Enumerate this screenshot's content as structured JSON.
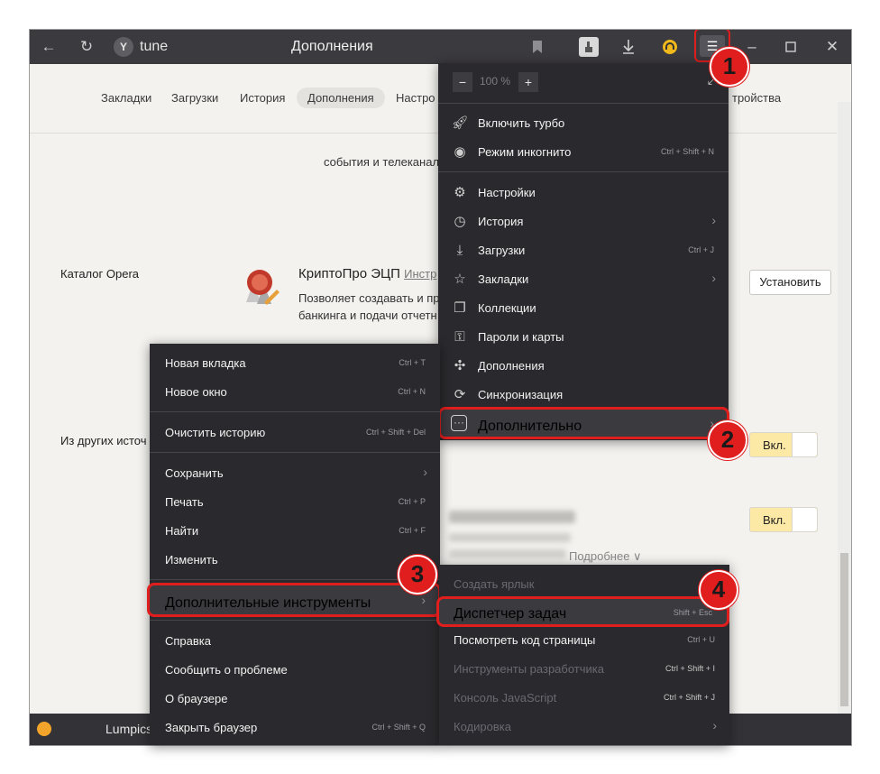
{
  "titlebar": {
    "address": "tune",
    "title": "Дополнения"
  },
  "tabs": [
    "Закладки",
    "Загрузки",
    "История",
    "Дополнения",
    "Настро",
    "тройства"
  ],
  "page": {
    "cut_text": "события и телеканалы \" д",
    "catalog_label": "Каталог Opera",
    "other_sources_label": "Из других источ",
    "extension": {
      "name": "КриптоПро ЭЦП",
      "link": "Инстр",
      "description": "Позволяет создавать и пр банкинга и подачи отчетн"
    },
    "install_label": "Установить",
    "toggle1_label": "Вкл.",
    "toggle2_label": "Вкл.",
    "more_link": "Подробнее ∨"
  },
  "taskbar": {
    "text": "Lumpics"
  },
  "main_menu": {
    "zoom_value": "100 %",
    "zoom_minus": "−",
    "zoom_plus": "+",
    "items": [
      {
        "label": "Включить турбо",
        "shortcut": ""
      },
      {
        "label": "Режим инкогнито",
        "shortcut": "Ctrl + Shift + N"
      },
      {
        "label": "Настройки",
        "shortcut": ""
      },
      {
        "label": "История",
        "shortcut": ""
      },
      {
        "label": "Загрузки",
        "shortcut": "Ctrl + J"
      },
      {
        "label": "Закладки",
        "shortcut": ""
      },
      {
        "label": "Коллекции",
        "shortcut": ""
      },
      {
        "label": "Пароли и карты",
        "shortcut": ""
      },
      {
        "label": "Дополнения",
        "shortcut": ""
      },
      {
        "label": "Синхронизация",
        "shortcut": ""
      },
      {
        "label": "Дополнительно",
        "shortcut": ""
      }
    ]
  },
  "more_menu": {
    "items": [
      {
        "label": "Новая вкладка",
        "shortcut": "Ctrl + T"
      },
      {
        "label": "Новое окно",
        "shortcut": "Ctrl + N"
      },
      {
        "label": "Очистить историю",
        "shortcut": "Ctrl + Shift + Del"
      },
      {
        "label": "Сохранить",
        "shortcut": ""
      },
      {
        "label": "Печать",
        "shortcut": "Ctrl + P"
      },
      {
        "label": "Найти",
        "shortcut": "Ctrl + F"
      },
      {
        "label": "Изменить",
        "shortcut": ""
      },
      {
        "label": "Дополнительные инструменты",
        "shortcut": ""
      },
      {
        "label": "Справка",
        "shortcut": ""
      },
      {
        "label": "Сообщить о проблеме",
        "shortcut": ""
      },
      {
        "label": "О браузере",
        "shortcut": ""
      },
      {
        "label": "Закрыть браузер",
        "shortcut": "Ctrl + Shift + Q"
      }
    ]
  },
  "tools_menu": {
    "items": [
      {
        "label": "Создать ярлык",
        "shortcut": ""
      },
      {
        "label": "Диспетчер задач",
        "shortcut": "Shift + Esc"
      },
      {
        "label": "Посмотреть код страницы",
        "shortcut": "Ctrl + U"
      },
      {
        "label": "Инструменты разработчика",
        "shortcut": "Ctrl + Shift + I"
      },
      {
        "label": "Консоль JavaScript",
        "shortcut": "Ctrl + Shift + J"
      },
      {
        "label": "Кодировка",
        "shortcut": ""
      }
    ]
  },
  "badges": [
    "1",
    "2",
    "3",
    "4"
  ],
  "colors": {
    "highlight": "#e01e1e",
    "menu_bg": "#2a292d",
    "titlebar_bg": "#3b3a3f",
    "toggle_on": "#fde9a6"
  }
}
